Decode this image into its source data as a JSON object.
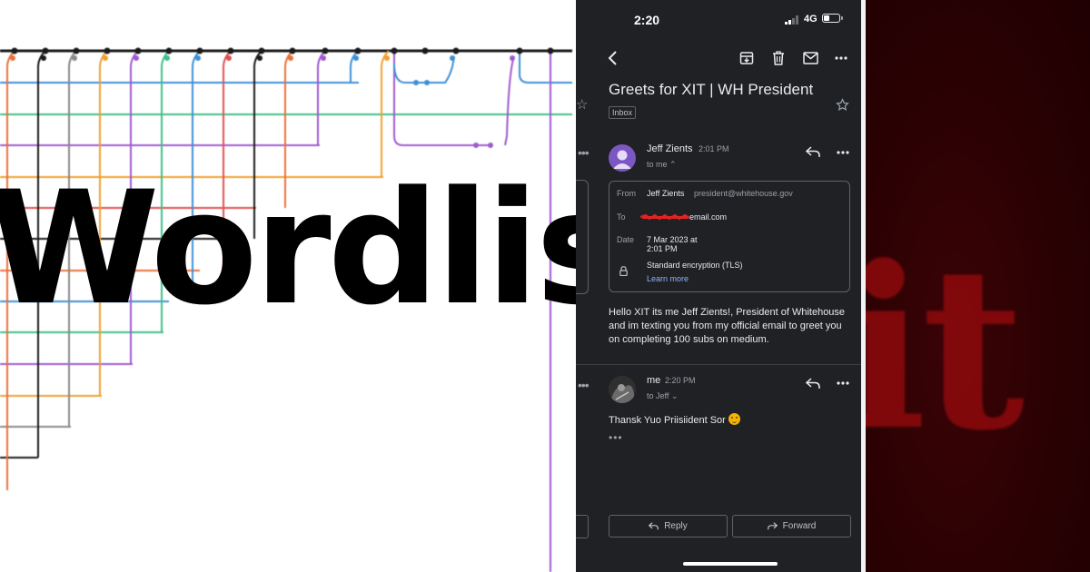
{
  "left_panel": {
    "wordmark": "Wordlist",
    "line_colors": [
      "#000000",
      "#e8703a",
      "#3d8fd6",
      "#8a8a8a",
      "#f0a030",
      "#a05ad0",
      "#3fbf8a",
      "#e05050"
    ]
  },
  "phone": {
    "status": {
      "time": "2:20",
      "network": "4G"
    },
    "toolbar_icons": [
      "back-icon",
      "archive-icon",
      "delete-icon",
      "mark-unread-icon",
      "more-icon"
    ],
    "email": {
      "subject": "Greets for XIT | WH President",
      "label": "Inbox",
      "sender_name": "Jeff Zients",
      "sender_time": "2:01 PM",
      "recipient_line": "to me",
      "details": {
        "from_label": "From",
        "from_name": "Jeff Zients",
        "from_email": "president@whitehouse.gov",
        "to_label": "To",
        "to_value": "email.com",
        "date_label": "Date",
        "date_line1": "7 Mar 2023 at",
        "date_line2": "2:01 PM",
        "security": "Standard encryption (TLS)",
        "learn_more": "Learn more"
      },
      "body": "Hello XIT its me Jeff Zients!, President of Whitehouse and im texting you from my official email to greet you on completing 100 subs on medium."
    },
    "reply": {
      "sender_name": "me",
      "sender_time": "2:20 PM",
      "recipient_line": "to Jeff",
      "text": "Thansk Yuo Priisiident Sor"
    },
    "actions": {
      "reply": "Reply",
      "forward": "Forward"
    },
    "colors": {
      "background": "#202124",
      "text": "#e8eaed",
      "link": "#8ab4f8",
      "avatar": "#7b57c4"
    }
  },
  "right_panel": {
    "brand_text": "it",
    "colors": {
      "background": "#2a0103",
      "text": "#8e0a0d"
    }
  }
}
